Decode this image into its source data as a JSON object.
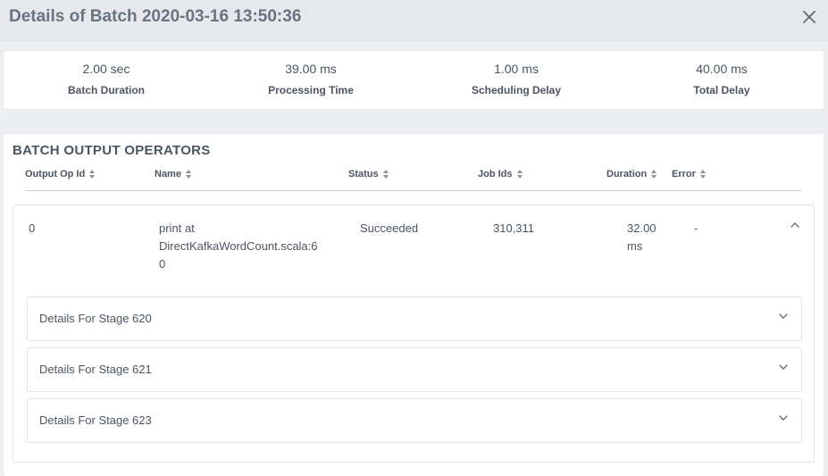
{
  "header": {
    "title": "Details of Batch 2020-03-16 13:50:36"
  },
  "summary": [
    {
      "value": "2.00 sec",
      "label": "Batch Duration"
    },
    {
      "value": "39.00 ms",
      "label": "Processing Time"
    },
    {
      "value": "1.00 ms",
      "label": "Scheduling Delay"
    },
    {
      "value": "40.00 ms",
      "label": "Total Delay"
    }
  ],
  "operators": {
    "title": "BATCH OUTPUT OPERATORS",
    "columns": [
      "Output Op Id",
      "Name",
      "Status",
      "Job Ids",
      "Duration",
      "Error"
    ],
    "rows": [
      {
        "id": "0",
        "name_line1": "print at",
        "name_line2": "DirectKafkaWordCount.scala:6",
        "name_line3": "0",
        "status": "Succeeded",
        "job_ids": "310,311",
        "duration_line1": "32.00",
        "duration_line2": "ms",
        "error": "-",
        "stages": [
          "Details For Stage 620",
          "Details For Stage 621",
          "Details For Stage 623"
        ]
      }
    ]
  },
  "icons": {
    "close": "close-icon",
    "sort": "sort-icon",
    "collapse": "chevron-up-icon",
    "expand": "chevron-down-icon"
  }
}
